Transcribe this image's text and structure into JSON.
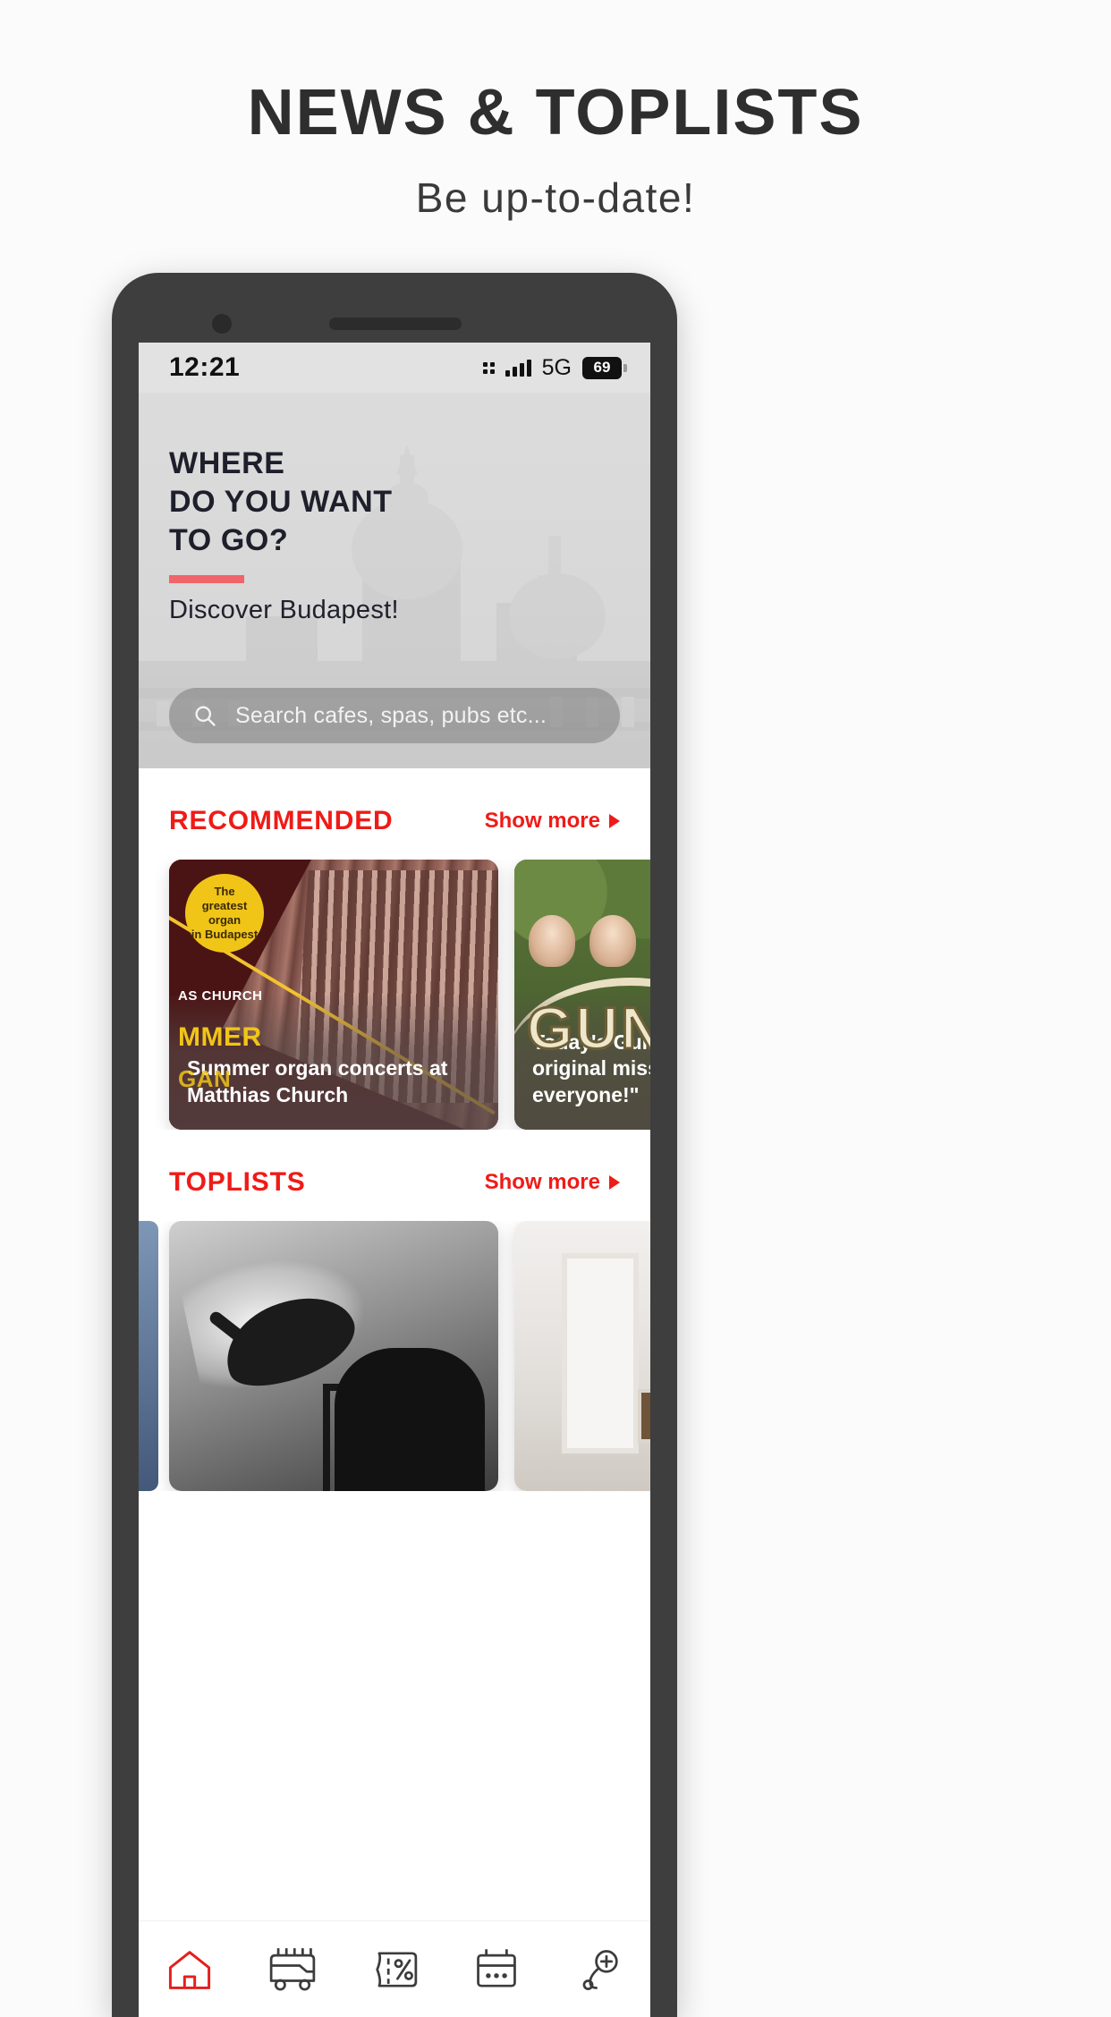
{
  "promo": {
    "title": "NEWS & TOPLISTS",
    "subtitle": "Be up-to-date!"
  },
  "statusbar": {
    "time": "12:21",
    "network": "5G",
    "battery": "69"
  },
  "hero": {
    "headline": "WHERE\nDO YOU WANT\nTO GO?",
    "subtitle": "Discover Budapest!",
    "accent_color": "#f0646b",
    "search_placeholder": "Search cafes, spas, pubs etc..."
  },
  "sections": [
    {
      "title": "RECOMMENDED",
      "show_more": "Show more",
      "cards": [
        {
          "caption": "Summer organ concerts at Matthias Church",
          "badge": "The greatest\norgan\nin Budapest",
          "poster_small": "AS CHURCH",
          "poster_big": "MMER",
          "poster_mid": "GAN"
        },
        {
          "caption": "Today's Gundel is original mission everyone!\"",
          "poster_word": "GUN"
        }
      ]
    },
    {
      "title": "TOPLISTS",
      "show_more": "Show more",
      "cards": [
        {
          "caption": ""
        },
        {
          "caption": ""
        }
      ]
    }
  ],
  "bottom_nav": {
    "items": [
      {
        "icon": "home-icon",
        "active": true
      },
      {
        "icon": "bus-icon",
        "active": false
      },
      {
        "icon": "discount-ticket-icon",
        "active": false
      },
      {
        "icon": "calendar-icon",
        "active": false
      },
      {
        "icon": "location-pin-icon",
        "active": false
      }
    ],
    "active_color": "#e41f1a",
    "inactive_color": "#3c3c3c"
  }
}
